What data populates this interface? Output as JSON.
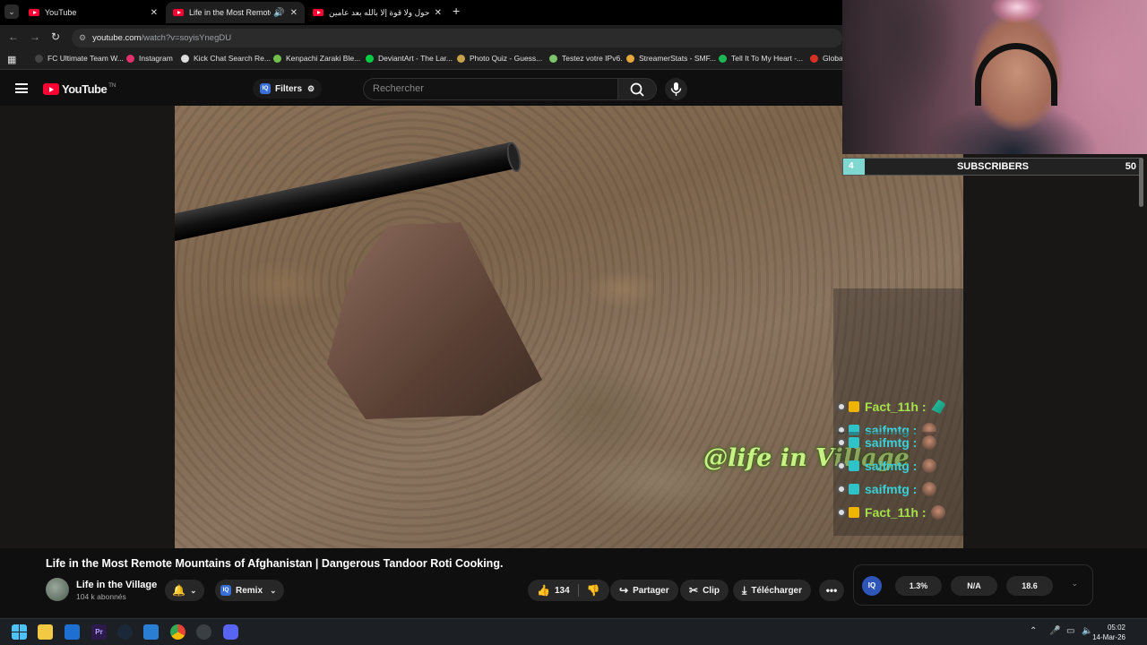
{
  "browser": {
    "tabs": [
      {
        "title": "YouTube",
        "active": false
      },
      {
        "title": "Life in the Most Remote Mo",
        "active": true
      },
      {
        "title": "ولا حول ولا قوة إلا بالله بعد عامين",
        "active": false
      }
    ],
    "address": {
      "host": "youtube.com",
      "path": "/watch?v=soyisYnegDU"
    },
    "bookmarks": [
      {
        "label": "FC Ultimate Team W...",
        "color": "#444444"
      },
      {
        "label": "Instagram",
        "color": "#e1306c"
      },
      {
        "label": "Kick Chat Search Re...",
        "color": "#dddddd"
      },
      {
        "label": "Kenpachi Zaraki Ble...",
        "color": "#6fbf4a"
      },
      {
        "label": "DeviantArt - The Lar...",
        "color": "#05cc47"
      },
      {
        "label": "Photo Quiz - Guess...",
        "color": "#c7a24a"
      },
      {
        "label": "Testez votre IPv6.",
        "color": "#7cc46a"
      },
      {
        "label": "StreamerStats - SMF...",
        "color": "#e6a83a"
      },
      {
        "label": "Tell It To My Heart -...",
        "color": "#1db954"
      },
      {
        "label": "Globa",
        "color": "#d93025"
      }
    ]
  },
  "youtube": {
    "logo_text": "YouTube",
    "logo_region": "TN",
    "filters_label": "Filters",
    "search_placeholder": "Rechercher"
  },
  "video": {
    "title": "Life in the Most Remote Mountains of Afghanistan | Dangerous Tandoor Roti Cooking.",
    "watermark": "@life in Village",
    "channel_name": "Life in the Village",
    "channel_subs": "104 k abonnés",
    "remix_label": "Remix",
    "likes": "134",
    "share_label": "Partager",
    "clip_label": "Clip",
    "download_label": "Télécharger"
  },
  "stream_overlay": {
    "subscribers_count": "4",
    "subscribers_label": "SUBSCRIBERS",
    "subscribers_goal": "50",
    "chat": [
      {
        "user": "Fact_11h :",
        "color": "#a5e04a",
        "badge": "#f0b400",
        "emote": "leaf"
      },
      {
        "user": "saifmtg :",
        "color": "#3ad0d8",
        "badge": "#2ec2c9",
        "emote": "face"
      },
      {
        "user": "saifmtg :",
        "color": "#3ad0d8",
        "badge": "#2ec2c9",
        "emote": "face"
      },
      {
        "user": "saifmtg :",
        "color": "#3ad0d8",
        "badge": "#2ec2c9",
        "emote": "face"
      },
      {
        "user": "saifmtg :",
        "color": "#3ad0d8",
        "badge": "#2ec2c9",
        "emote": "face"
      },
      {
        "user": "Fact_11h :",
        "color": "#a5e04a",
        "badge": "#f0b400",
        "emote": "face"
      }
    ]
  },
  "iq_widget": {
    "logo": "IQ",
    "stats": [
      "1.3%",
      "N/A",
      "18.6"
    ]
  },
  "taskbar": {
    "time": "05:02",
    "date": "14-Mar-26"
  }
}
